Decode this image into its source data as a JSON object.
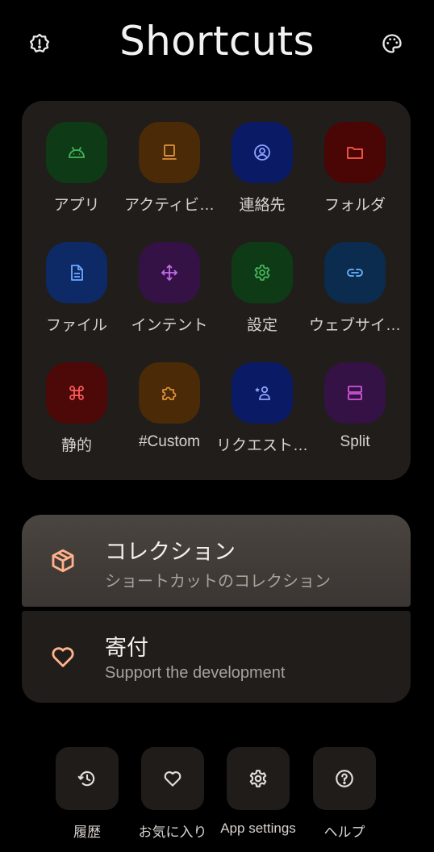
{
  "header": {
    "title": "Shortcuts",
    "left_icon": "report-icon",
    "right_icon": "palette-icon"
  },
  "grid": [
    {
      "label": "アプリ",
      "icon": "android-icon",
      "bg": "#0e3b16",
      "fg": "#43b55a"
    },
    {
      "label": "アクティビ…",
      "icon": "activity-icon",
      "bg": "#4a2a07",
      "fg": "#e0913a"
    },
    {
      "label": "連絡先",
      "icon": "contact-icon",
      "bg": "#0a1a64",
      "fg": "#8fa3ff"
    },
    {
      "label": "フォルダ",
      "icon": "folder-icon",
      "bg": "#4a0505",
      "fg": "#ff5a4a"
    },
    {
      "label": "ファイル",
      "icon": "file-icon",
      "bg": "#0d2a66",
      "fg": "#6ea8ff"
    },
    {
      "label": "インテント",
      "icon": "intent-icon",
      "bg": "#351245",
      "fg": "#c06bea"
    },
    {
      "label": "設定",
      "icon": "settings-icon",
      "bg": "#0e3b16",
      "fg": "#43b55a"
    },
    {
      "label": "ウェブサイ…",
      "icon": "link-icon",
      "bg": "#0b2c4e",
      "fg": "#6ab4ff"
    },
    {
      "label": "静的",
      "icon": "command-icon",
      "bg": "#4d0808",
      "fg": "#ff5a5a"
    },
    {
      "label": "#Custom",
      "icon": "puzzle-icon",
      "bg": "#4a2a07",
      "fg": "#e0913a"
    },
    {
      "label": "リクエスト…",
      "icon": "person-star-icon",
      "bg": "#0a1a64",
      "fg": "#8fa3ff"
    },
    {
      "label": "Split",
      "icon": "split-icon",
      "bg": "#351245",
      "fg": "#d056d8"
    }
  ],
  "list": {
    "collection": {
      "title": "コレクション",
      "subtitle": "ショートカットのコレクション",
      "icon": "box-icon"
    },
    "donate": {
      "title": "寄付",
      "subtitle": "Support the development",
      "icon": "heart-icon"
    }
  },
  "bottom": [
    {
      "label": "履歴",
      "icon": "history-icon"
    },
    {
      "label": "お気に入り",
      "icon": "heart-outline-icon"
    },
    {
      "label": "App settings",
      "icon": "gear-icon"
    },
    {
      "label": "ヘルプ",
      "icon": "help-icon"
    }
  ],
  "colors": {
    "background": "#000000",
    "card": "#211d1a",
    "accent": "#ffb28a"
  }
}
